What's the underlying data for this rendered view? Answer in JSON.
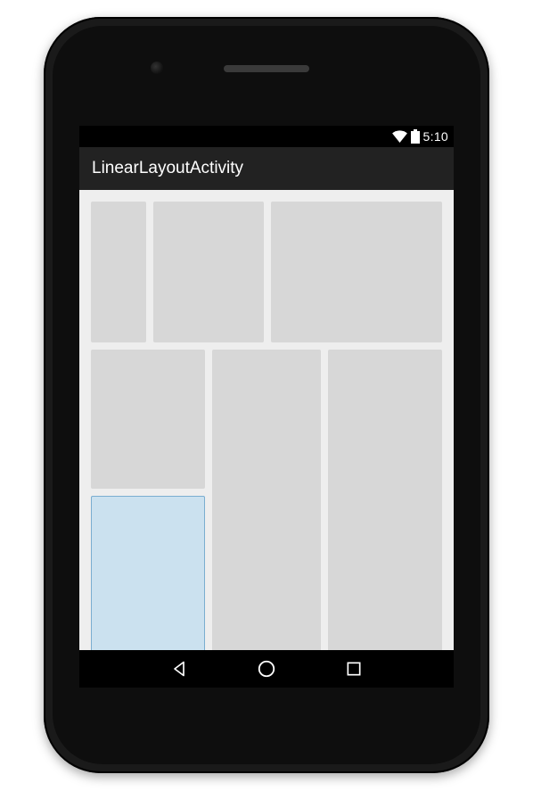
{
  "status": {
    "clock": "5:10",
    "wifi_icon": "wifi",
    "battery_icon": "battery"
  },
  "action_bar": {
    "title": "LinearLayoutActivity"
  },
  "nav": {
    "back": "back",
    "home": "home",
    "recents": "recents"
  },
  "layout": {
    "row1": [
      {
        "name": "block-r1c1"
      },
      {
        "name": "block-r1c2"
      },
      {
        "name": "block-r1c3"
      }
    ],
    "row2": {
      "left": {
        "top": {
          "name": "block-r2-left-top"
        },
        "bottom": {
          "name": "block-r2-left-bottom",
          "selected": true
        }
      },
      "mid": {
        "name": "block-r2c2"
      },
      "right": {
        "name": "block-r2c3"
      }
    }
  },
  "colors": {
    "block": "#d7d7d7",
    "selected_fill": "#cbe1ef",
    "selected_border": "#7aaed0",
    "content_bg": "#eeeeee",
    "action_bar": "#222222"
  }
}
